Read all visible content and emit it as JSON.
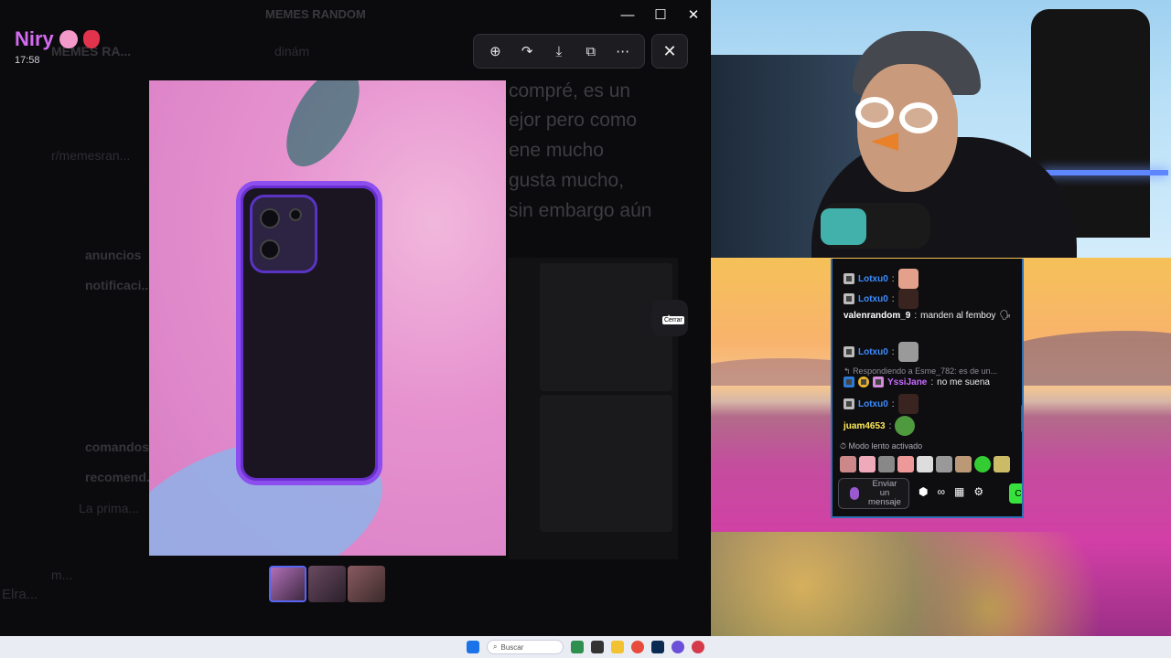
{
  "discord": {
    "window_title": "MEMES RANDOM",
    "channel_header": "MEMES RA...",
    "channel_tab": "dinám",
    "background_message_lines": [
      "compré, es un",
      "ejor pero como",
      "ene mucho",
      "gusta mucho,",
      "sin embargo aún"
    ],
    "background_sidebar": [
      "r/memesran...",
      "anuncios",
      "notificaci...",
      "comandos",
      "recomend...",
      "La prima...",
      "m..."
    ],
    "bottom_user": "Elra...",
    "author": {
      "name": "Niry",
      "time": "17:58"
    },
    "viewer": {
      "tooltip": "Cerrar",
      "thumbnail_count": 3
    },
    "controls": {
      "zoom_icon": "zoom-in-icon",
      "share_icon": "forward-icon",
      "download_icon": "download-icon",
      "open_icon": "open-external-icon",
      "more_icon": "more-icon",
      "close_icon": "close-icon"
    }
  },
  "chat": {
    "messages": [
      {
        "user": "Lotxu0",
        "text": "",
        "color": "#3c8cff"
      },
      {
        "user": "Lotxu0",
        "text": "",
        "color": "#3c8cff"
      },
      {
        "user": "valenrandom_9",
        "text": "manden al femboy",
        "color": "#ffffff"
      },
      {
        "user": "Lotxu0",
        "text": "",
        "color": "#3c8cff"
      },
      {
        "user": "YssiJane",
        "text": "no me suena",
        "color": "#c86cff"
      },
      {
        "user": "Lotxu0",
        "text": "",
        "color": "#3c8cff"
      },
      {
        "user": "juam4653",
        "text": "",
        "color": "#ffeb5a"
      }
    ],
    "reply_text": "Respondiendo a Esme_782: es de un...",
    "slow_mode": "Modo lento activado",
    "input_placeholder": "Enviar un mensaje",
    "send_label": "C"
  },
  "taskbar": {
    "search_placeholder": "Buscar"
  }
}
